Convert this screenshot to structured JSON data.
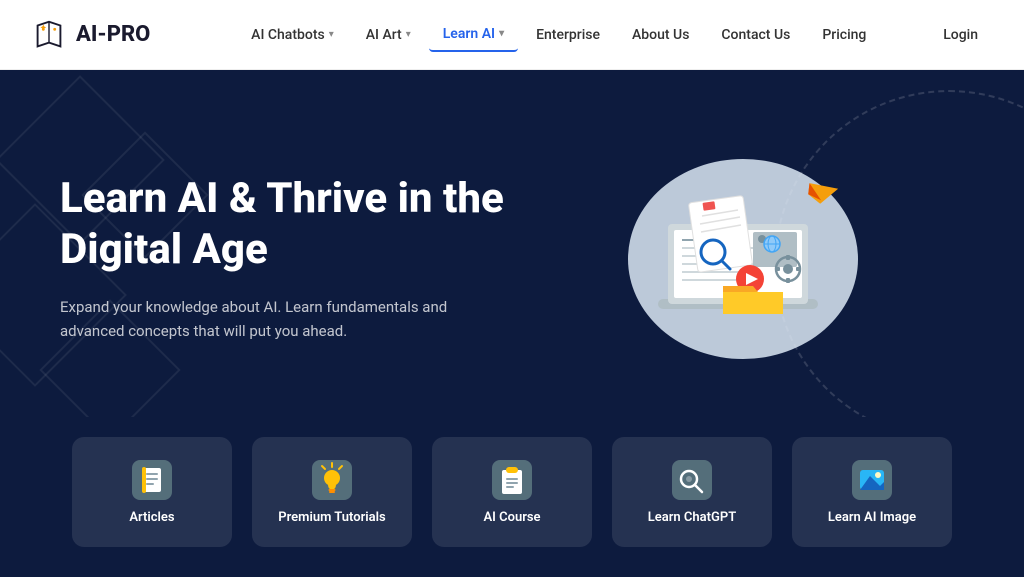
{
  "brand": {
    "name": "AI-PRO"
  },
  "nav": {
    "items": [
      {
        "label": "AI Chatbots",
        "hasDropdown": true,
        "active": false
      },
      {
        "label": "AI Art",
        "hasDropdown": true,
        "active": false
      },
      {
        "label": "Learn AI",
        "hasDropdown": true,
        "active": true
      },
      {
        "label": "Enterprise",
        "hasDropdown": false,
        "active": false
      },
      {
        "label": "About Us",
        "hasDropdown": false,
        "active": false
      },
      {
        "label": "Contact Us",
        "hasDropdown": false,
        "active": false
      },
      {
        "label": "Pricing",
        "hasDropdown": false,
        "active": false
      }
    ],
    "login_label": "Login"
  },
  "hero": {
    "title": "Learn AI & Thrive in the Digital Age",
    "subtitle": "Expand your knowledge about AI. Learn fundamentals and advanced concepts that will put you ahead."
  },
  "cards": [
    {
      "id": "articles",
      "label": "Articles",
      "icon": "article"
    },
    {
      "id": "premium-tutorials",
      "label": "Premium Tutorials",
      "icon": "bulb"
    },
    {
      "id": "ai-course",
      "label": "AI  Course",
      "icon": "clipboard"
    },
    {
      "id": "learn-chatgpt",
      "label": "Learn ChatGPT",
      "icon": "search-chat"
    },
    {
      "id": "learn-ai-image",
      "label": "Learn AI Image",
      "icon": "image"
    }
  ],
  "colors": {
    "brand_blue": "#2563eb",
    "hero_bg": "#0d1b3e",
    "card_bg": "rgba(255,255,255,0.1)"
  }
}
